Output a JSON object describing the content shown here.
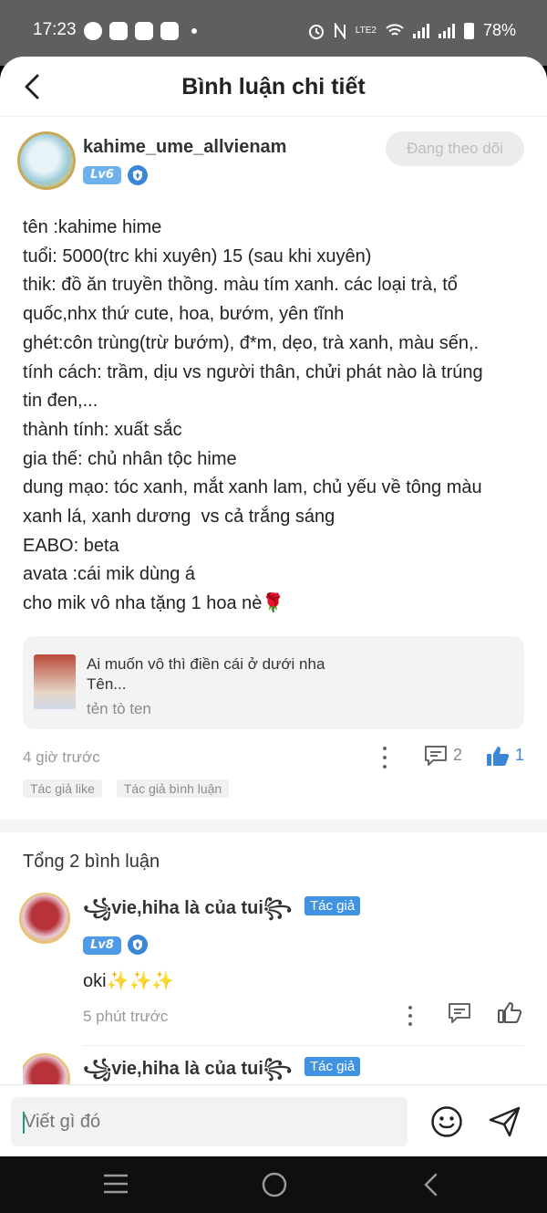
{
  "status_bar": {
    "time": "17:23",
    "left_icons": [
      "cat-app-icon",
      "h-app-icon",
      "youtube-icon",
      "h-app-icon"
    ],
    "right_icons": [
      "alarm-icon",
      "nfc-icon",
      "volte-icon",
      "wifi-icon",
      "signal-icon",
      "signal-icon",
      "battery-icon"
    ],
    "lte_label": "LTE2",
    "battery": "78%"
  },
  "header": {
    "title": "Bình luận chi tiết",
    "back_icon": "chevron-left-icon"
  },
  "post": {
    "author": "kahime_ume_allvienam",
    "level": "Lv6",
    "follow_label": "Đang theo dõi",
    "body_lines": [
      "tên :kahime hime",
      "tuổi: 5000(trc khi xuyên) 15 (sau khi xuyên)",
      "thik: đồ ăn truyền thồng. màu tím xanh. các loại trà, tổ",
      "quốc,nhx thứ cute, hoa, bướm, yên tĩnh",
      "ghét:côn trùng(trừ bướm), đ*m, dẹo, trà xanh, màu sến,.",
      "tính cách: trầm, dịu vs người thân, chửi phát nào là trúng",
      "tin đen,...",
      "thành tính: xuất sắc",
      "gia thế: chủ nhân tộc hime",
      "dung mạo: tóc xanh, mắt xanh lam, chủ yếu về tông màu",
      "xanh lá, xanh dương  vs cả trắng sáng",
      "EABO: beta",
      "avata :cái mik dùng á",
      "cho mik vô nha tặng 1 hoa nè🌹"
    ],
    "linked": {
      "title_line1": "Ai muốn vô thì điền cái ở dưới nha",
      "title_line2": "Tên...",
      "subtitle": "tẻn tò ten"
    },
    "time": "4 giờ trước",
    "comment_count": "2",
    "like_count": "1",
    "tags": [
      "Tác giả like",
      "Tác giả bình luận"
    ]
  },
  "comments": {
    "total_label": "Tổng 2 bình luận",
    "items": [
      {
        "name": "꧁vie,hiha là của tui꧂",
        "author_tag": "Tác giả",
        "level": "Lv8",
        "text": "oki✨✨✨",
        "time": "5 phút trước"
      },
      {
        "name": "꧁vie,hiha là của tui꧂",
        "author_tag": "Tác giả"
      }
    ]
  },
  "input": {
    "placeholder": "Viết gì đó"
  },
  "navbar": {
    "icons": [
      "menu-icon",
      "home-circle-icon",
      "back-icon"
    ]
  },
  "colors": {
    "accent": "#3a87d6",
    "tag_blue": "#3f93e0",
    "cursor": "#1a9a86"
  }
}
